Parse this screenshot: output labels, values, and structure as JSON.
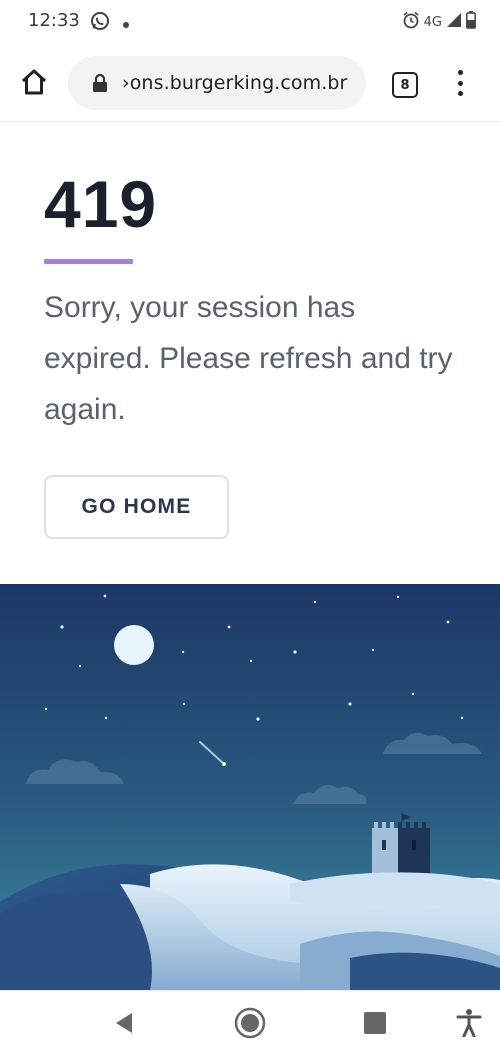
{
  "status_bar": {
    "time": "12:33",
    "network": "4G",
    "icons": [
      "whatsapp-icon",
      "dot-icon",
      "alarm-icon",
      "signal-icon",
      "battery-icon"
    ]
  },
  "browser": {
    "url": "›ons.burgerking.com.br",
    "tab_count": "8",
    "icons": [
      "home-icon",
      "lock-icon",
      "tabs-icon",
      "more-vert-icon"
    ]
  },
  "page": {
    "error_code": "419",
    "message": "Sorry, your session has expired. Please refresh and try again.",
    "button_label": "GO HOME",
    "accent_color": "#a67fe0"
  },
  "navigation": {
    "icons": [
      "back-icon",
      "home-circle-icon",
      "recents-icon",
      "accessibility-icon"
    ]
  }
}
